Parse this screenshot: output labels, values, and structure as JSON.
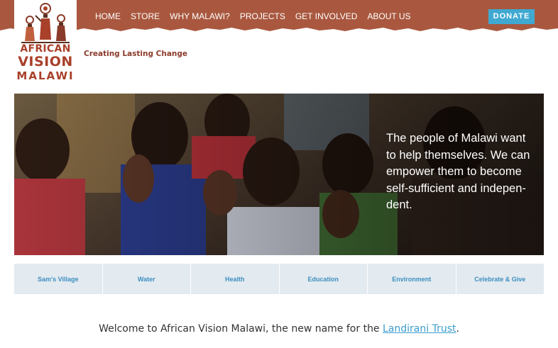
{
  "colors": {
    "band": "#a9583f",
    "logo_text": "#a9402a",
    "donate_bg": "#3fa9d2",
    "tab_bg": "#e3eaf0",
    "tab_text": "#3d8fc0",
    "link": "#3a9ccf"
  },
  "logo": {
    "line1": "AFRICAN",
    "line2": "VISION",
    "line3": "MALAWI",
    "icon": "figures-carrying-baskets-icon"
  },
  "nav": {
    "items": [
      {
        "label": "HOME"
      },
      {
        "label": "STORE"
      },
      {
        "label": "WHY MALAWI?"
      },
      {
        "label": "PROJECTS"
      },
      {
        "label": "GET INVOLVED"
      },
      {
        "label": "ABOUT US"
      }
    ],
    "donate_label": "DONATE"
  },
  "tagline": "Creating Lasting Change",
  "hero": {
    "text": "The people of Malawi want to help themselves. We can empower them to become self-sufficient and indepen-dent."
  },
  "tabs": [
    {
      "label": "Sam's Village"
    },
    {
      "label": "Water"
    },
    {
      "label": "Health"
    },
    {
      "label": "Education"
    },
    {
      "label": "Environment"
    },
    {
      "label": "Celebrate & Give"
    }
  ],
  "welcome": {
    "text_before": "Welcome to African Vision Malawi, the new name for the ",
    "link_text": "Landirani Trust",
    "text_after": "."
  }
}
